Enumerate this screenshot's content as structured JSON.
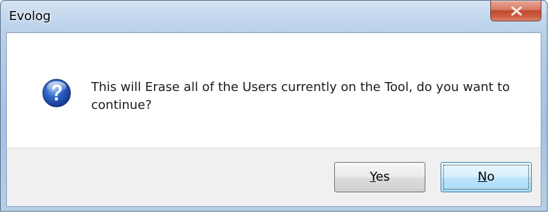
{
  "window": {
    "title": "Evolog",
    "close_icon": "close-icon"
  },
  "dialog": {
    "icon": "question-icon",
    "message": "This will Erase all of the Users currently on the Tool, do you want to continue?"
  },
  "buttons": {
    "yes_mnemonic": "Y",
    "yes_rest": "es",
    "no_mnemonic": "N",
    "no_rest": "o"
  },
  "colors": {
    "title_bar": "#aecbe9",
    "close_button": "#c24a2f",
    "default_button": "#bee6fd",
    "footer": "#f0f0f0"
  }
}
